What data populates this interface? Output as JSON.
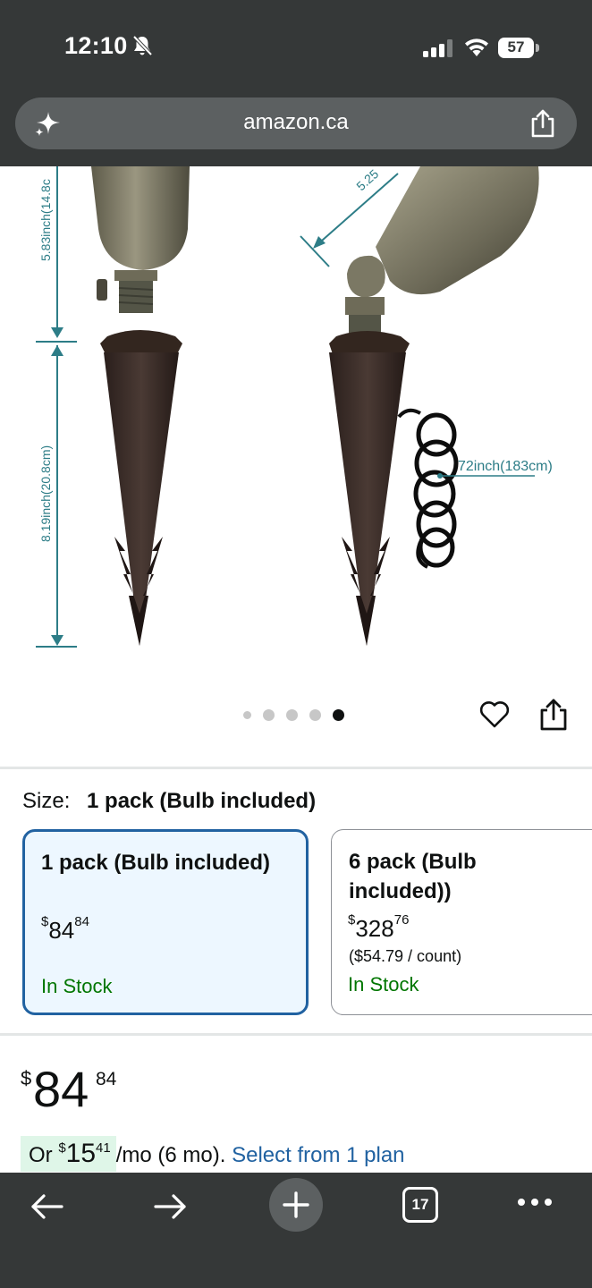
{
  "status_bar": {
    "time": "12:10",
    "battery": "57",
    "icons": [
      "bell-off-icon",
      "signal-icon",
      "wifi-icon",
      "battery-icon"
    ]
  },
  "browser": {
    "url": "amazon.ca",
    "left_icon": "sparkle-icon",
    "right_icon": "share-icon"
  },
  "product_image": {
    "dimension_labels": {
      "head_height": "5.83inch(14.8c",
      "stake_height": "8.19inch(20.8cm)",
      "head_length": "5.25",
      "cable_length": "72inch(183cm)"
    },
    "carousel": {
      "total": 5,
      "active_index": 4
    }
  },
  "size": {
    "label": "Size:",
    "selected_value": "1 pack (Bulb included)",
    "options": [
      {
        "title": "1 pack (Bulb included)",
        "currency": "$",
        "price_whole": "84",
        "price_fraction": "84",
        "unit_price": "",
        "stock": "In Stock",
        "selected": true
      },
      {
        "title": "6 pack (Bulb included))",
        "currency": "$",
        "price_whole": "328",
        "price_fraction": "76",
        "unit_price": "($54.79 / count)",
        "stock": "In Stock",
        "selected": false
      }
    ]
  },
  "price": {
    "currency": "$",
    "whole": "84",
    "fraction": "84"
  },
  "installment": {
    "prefix": "Or ",
    "currency": "$",
    "whole": "15",
    "fraction": "41",
    "term": "/mo (6 mo). ",
    "link": "Select from 1 plan"
  },
  "toolbar": {
    "tab_count": "17",
    "icons": [
      "back-arrow-icon",
      "forward-arrow-icon",
      "plus-icon",
      "tabs-icon",
      "more-icon"
    ]
  },
  "colors": {
    "chrome": "#353838",
    "url_bar": "#5c6061",
    "selected_border": "#2162a1",
    "selected_bg": "#edf7ff",
    "in_stock": "#007600",
    "link": "#2162a1",
    "dimension_lines": "#2d7d87"
  }
}
